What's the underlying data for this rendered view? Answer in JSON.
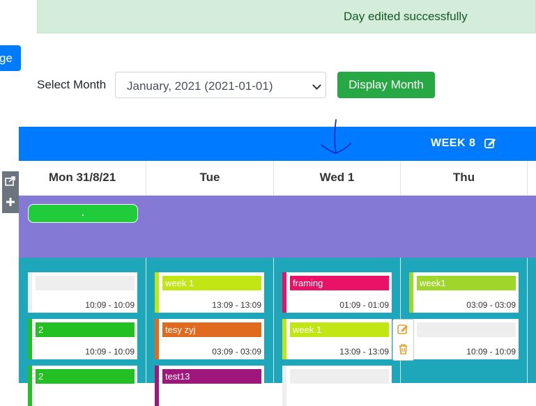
{
  "alert": {
    "message": "Day edited successfully"
  },
  "left_button": {
    "label": "ge"
  },
  "select_month": {
    "label": "Select Month",
    "value": "January, 2021 (2021-01-01)"
  },
  "display_button": {
    "label": "Display Month"
  },
  "week": {
    "label": "WEEK 8"
  },
  "days": [
    "Mon 31/8/21",
    "Tue",
    "Wed 1",
    "Thu"
  ],
  "purple_pill": {
    "label": "."
  },
  "cards": [
    {
      "title": ".",
      "time": "10:09 - 10:09",
      "color": "#eeeeee",
      "stripe": "#eeeeee"
    },
    {
      "title": "2",
      "time": "10:09 - 10:09",
      "color": "#22c022",
      "stripe": "#22c022"
    },
    {
      "title": "2",
      "time": "",
      "color": "#22c022",
      "stripe": "#22c022"
    },
    {
      "title": "week 1",
      "time": "13:09 - 13:09",
      "color": "#c2e613",
      "stripe": "#c2e613"
    },
    {
      "title": "tesy zyj",
      "time": "03:09 - 03:09",
      "color": "#e06a1e",
      "stripe": "#e06a1e"
    },
    {
      "title": "test13",
      "time": "",
      "color": "#a0177b",
      "stripe": "#a0177b"
    },
    {
      "title": "framing",
      "time": "01:09 - 01:09",
      "color": "#ea1266",
      "stripe": "#ea1266"
    },
    {
      "title": "week 1",
      "time": "13:09 - 13:09",
      "color": "#c2e613",
      "stripe": "#c2e613"
    },
    {
      "title": ".",
      "time": "",
      "color": "#eeeeee",
      "stripe": "#eeeeee"
    },
    {
      "title": "week1",
      "time": "03:09 - 03:09",
      "color": "#9ed62a",
      "stripe": "#9ed62a"
    },
    {
      "title": ".",
      "time": "10:09 - 10:09",
      "color": "#eeeeee",
      "stripe": "#eeeeee"
    }
  ],
  "colors": {
    "primary": "#007bff",
    "success": "#28a745",
    "purple": "#8479d5",
    "teal": "#1ea6ba"
  }
}
